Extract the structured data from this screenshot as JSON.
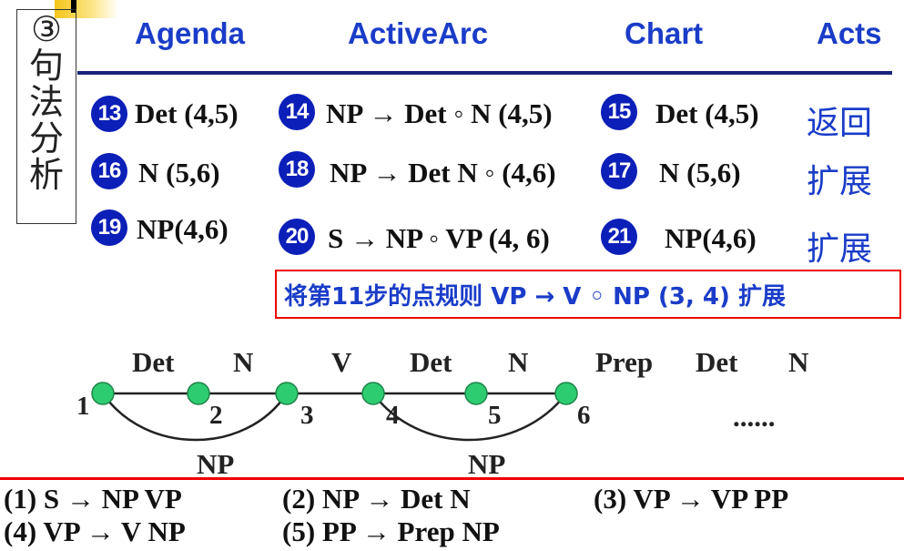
{
  "side_title": "③\n句\n法\n分\n析",
  "headers": {
    "agenda": "Agenda",
    "active_arc": "ActiveArc",
    "chart": "Chart",
    "acts": "Acts"
  },
  "rows": [
    {
      "agenda_num": "13",
      "agenda": "Det (4,5)",
      "arc_num": "14",
      "arc": "NP → Det ◦ N (4,5)",
      "chart_num": "15",
      "chart": "Det (4,5)",
      "act": "返回"
    },
    {
      "agenda_num": "16",
      "agenda": "N (5,6)",
      "arc_num": "18",
      "arc": "NP → Det N ◦ (4,6)",
      "chart_num": "17",
      "chart": "N (5,6)",
      "act": "扩展"
    },
    {
      "agenda_num": "19",
      "agenda": "NP(4,6)",
      "arc_num": "20",
      "arc": "S → NP ◦ VP (4, 6)",
      "chart_num": "21",
      "chart": "NP(4,6)",
      "act": "扩展"
    }
  ],
  "note": "将第11步的点规则 VP  → V ◦ NP (3, 4) 扩展",
  "graph": {
    "categories": [
      "Det",
      "N",
      "V",
      "Det",
      "N",
      "Prep",
      "Det",
      "N"
    ],
    "node_numbers": [
      "1",
      "2",
      "3",
      "4",
      "5",
      "6"
    ],
    "arc_labels": [
      "NP",
      "NP"
    ],
    "ellipsis": "......",
    "node_color": "#2ecc71",
    "arc_color": "#222222"
  },
  "rules": [
    "(1) S → NP  VP",
    "(2) NP  → Det  N",
    "(3) VP  → VP  PP",
    "(4) VP  → V  NP",
    "(5) PP  → Prep  NP"
  ],
  "colors": {
    "header_blue": "#1a3cc8",
    "badge_blue": "#0c1fb8",
    "rule_red": "#ee0000",
    "divider_navy": "#1a237e"
  }
}
